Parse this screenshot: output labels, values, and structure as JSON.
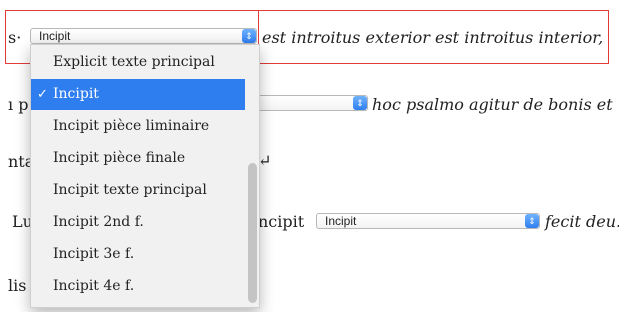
{
  "row1": {
    "prefix": "s·",
    "select_value": "Incipit",
    "after_text": "est introitus exterior est introitus interior,"
  },
  "row2": {
    "prefix": "ı p",
    "after_text": "hoc psalmo agitur de bonis et"
  },
  "row3": {
    "prefix": "nta",
    "suffix": "↵"
  },
  "row4": {
    "prefix": "Lu",
    "middle_text": "ncipit",
    "select_value": "Incipit",
    "after_text": "fecit deu."
  },
  "row5": {
    "prefix": "lis"
  },
  "dropdown": {
    "items": [
      {
        "label": "Explicit texte principal"
      },
      {
        "label": "Incipit",
        "checkmark": "✓"
      },
      {
        "label": "Incipit pièce liminaire"
      },
      {
        "label": "Incipit pièce finale"
      },
      {
        "label": "Incipit texte principal"
      },
      {
        "label": "Incipit 2nd f."
      },
      {
        "label": "Incipit 3e f."
      },
      {
        "label": "Incipit 4e f."
      }
    ]
  },
  "colors": {
    "accent": "#2f7ef0",
    "highlight_box": "#e23b3b"
  }
}
